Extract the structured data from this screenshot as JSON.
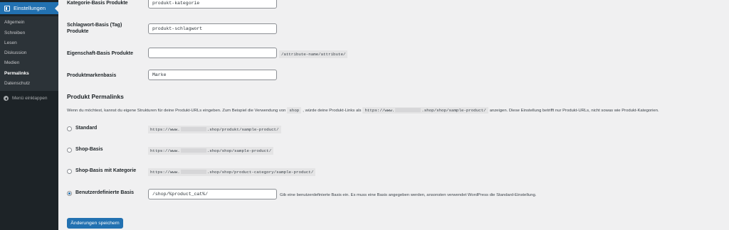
{
  "sidebar": {
    "menu_title": "Einstellungen",
    "items": [
      {
        "label": "Allgemein"
      },
      {
        "label": "Schreiben"
      },
      {
        "label": "Lesen"
      },
      {
        "label": "Diskussion"
      },
      {
        "label": "Medien"
      },
      {
        "label": "Permalinks"
      },
      {
        "label": "Datenschutz"
      }
    ],
    "collapse_label": "Menü einklappen"
  },
  "fields": {
    "category_base": {
      "label": "Kategorie-Basis Produkte",
      "value": "produkt-kategorie"
    },
    "tag_base": {
      "label_line1": "Schlagwort-Basis (Tag)",
      "label_line2": "Produkte",
      "value": "produkt-schlagwort"
    },
    "attribute_base": {
      "label": "Eigenschaft-Basis Produkte",
      "value": "",
      "suffix": "/attribute-name/attribute/"
    },
    "brand_base": {
      "label": "Produktmarkenbasis",
      "value": "Marke"
    }
  },
  "permalinks": {
    "title": "Produkt Permalinks",
    "desc_part1": "Wenn du möchtest, kannst du eigene Strukturen für deine Produkt-URLs eingeben. Zum Beispiel die Verwendung von",
    "desc_code1": "shop",
    "desc_part2": ", würde deine Produkt-Links als",
    "desc_code2_prefix": "https://www.",
    "desc_code2_suffix": ".shop/shop/sample-product/",
    "desc_part3": "anzeigen. Diese Einstellung betrifft nur Produkt-URLs, nicht sowas wie Produkt-Kategorien.",
    "options": [
      {
        "label": "Standard",
        "url_prefix": "https://www.",
        "url_suffix": ".shop/produkt/sample-product/",
        "checked": false
      },
      {
        "label": "Shop-Basis",
        "url_prefix": "https://www.",
        "url_suffix": ".shop/shop/sample-product/",
        "checked": false
      },
      {
        "label": "Shop-Basis mit Kategorie",
        "url_prefix": "https://www.",
        "url_suffix": ".shop/shop/product-category/sample-product/",
        "checked": false
      },
      {
        "label": "Benutzerdefinierte Basis",
        "value": "/shop/%product_cat%/",
        "checked": true
      }
    ],
    "custom_hint": "Gib eine benutzerdefinierte Basis ein. Es muss eine Basis angegeben werden, ansonsten verwendet WordPress die Standard-Einstellung."
  },
  "save_button": "Änderungen speichern"
}
